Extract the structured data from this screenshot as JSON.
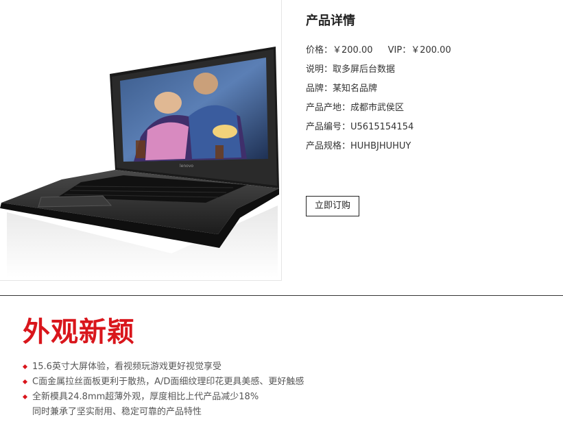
{
  "details": {
    "title": "产品详情",
    "price_label": "价格：",
    "price_value": "￥200.00",
    "vip_label": "VIP：",
    "vip_value": "￥200.00",
    "specs": [
      {
        "label": "说明：",
        "value": "取多屏后台数据"
      },
      {
        "label": "品牌：",
        "value": "某知名品牌"
      },
      {
        "label": "产品产地：",
        "value": "成都市武侯区"
      },
      {
        "label": "产品编号：",
        "value": "U5615154154"
      },
      {
        "label": "产品规格：",
        "value": "HUHBJHUHUY"
      }
    ],
    "buy_label": "立即订购"
  },
  "product_image": {
    "icon": "laptop-photo",
    "brand_text": "lenovo"
  },
  "feature": {
    "heading": "外观新颖",
    "items": [
      "15.6英寸大屏体验，看视频玩游戏更好视觉享受",
      "C面金属拉丝面板更利于散热，A/D面细纹理印花更具美感、更好触感",
      "全新模具24.8mm超薄外观，厚度相比上代产品减少18%"
    ],
    "continuation": "同时兼承了坚实耐用、稳定可靠的产品特性"
  },
  "colors": {
    "accent": "#d9161c",
    "text": "#333333"
  }
}
